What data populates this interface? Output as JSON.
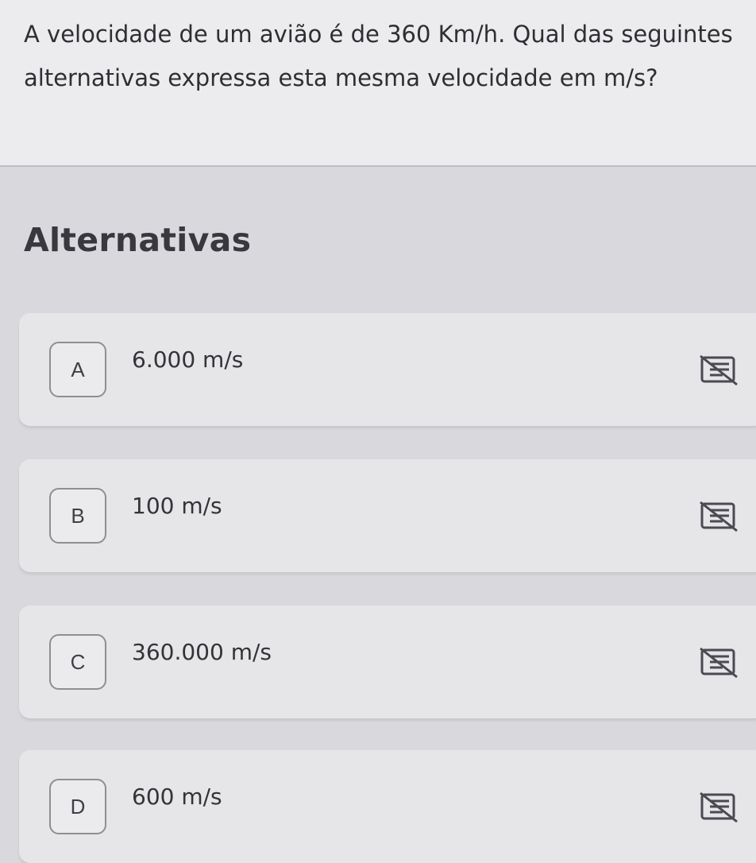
{
  "question": {
    "text": "A velocidade de um avião é de 360 Km/h. Qual das seguintes alternativas expressa esta mesma velocidade em m/s?"
  },
  "section_title": "Alternativas",
  "options": [
    {
      "letter": "A",
      "text": "6.000 m/s",
      "icon": "strikethrough-eliminate-icon"
    },
    {
      "letter": "B",
      "text": "100 m/s",
      "icon": "strikethrough-eliminate-icon"
    },
    {
      "letter": "C",
      "text": "360.000 m/s",
      "icon": "strikethrough-eliminate-icon"
    },
    {
      "letter": "D",
      "text": "600 m/s",
      "icon": "strikethrough-eliminate-icon"
    }
  ],
  "colors": {
    "background": "#d9d8dc",
    "card": "#e6e5e8",
    "text": "#2e2e33",
    "border": "#8f8e94"
  }
}
